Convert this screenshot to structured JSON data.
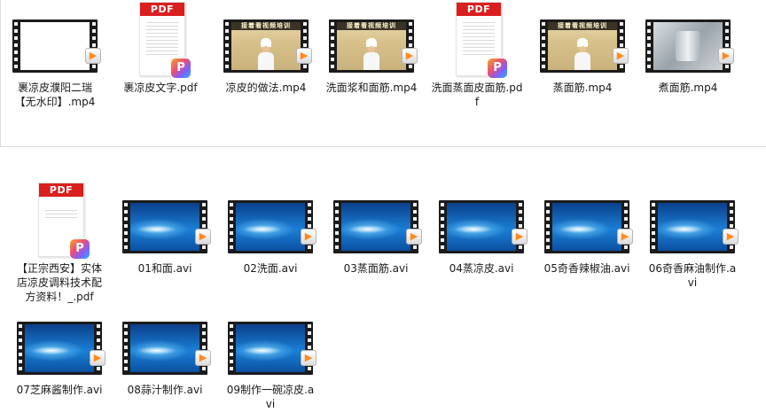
{
  "groups": [
    {
      "items": [
        {
          "type": "video",
          "thumb": "blank",
          "label": "裹凉皮濮阳二瑞【无水印】.mp4"
        },
        {
          "type": "pdf",
          "thumb": "text",
          "label": "裹凉皮文字.pdf"
        },
        {
          "type": "video",
          "thumb": "chef",
          "label": "凉皮的做法.mp4"
        },
        {
          "type": "video",
          "thumb": "chef",
          "label": "洗面浆和面筋.mp4"
        },
        {
          "type": "pdf",
          "thumb": "text",
          "label": "洗面蒸面皮面筋.pdf"
        },
        {
          "type": "video",
          "thumb": "chef",
          "label": "蒸面筋.mp4"
        },
        {
          "type": "video",
          "thumb": "steel",
          "label": "煮面筋.mp4"
        }
      ]
    },
    {
      "items": [
        {
          "type": "pdf",
          "thumb": "sparse",
          "label": "【正宗西安】实体店凉皮调料技术配方资料！_.pdf"
        },
        {
          "type": "video",
          "thumb": "wave",
          "label": "01和面.avi"
        },
        {
          "type": "video",
          "thumb": "wave",
          "label": "02洗面.avi"
        },
        {
          "type": "video",
          "thumb": "wave",
          "label": "03蒸面筋.avi"
        },
        {
          "type": "video",
          "thumb": "wave",
          "label": "04蒸凉皮.avi"
        },
        {
          "type": "video",
          "thumb": "wave",
          "label": "05奇香辣椒油.avi"
        },
        {
          "type": "video",
          "thumb": "wave",
          "label": "06奇香麻油制作.avi"
        },
        {
          "type": "video",
          "thumb": "wave",
          "label": "07芝麻酱制作.avi"
        },
        {
          "type": "video",
          "thumb": "wave",
          "label": "08蒜汁制作.avi"
        },
        {
          "type": "video",
          "thumb": "wave",
          "label": "09制作一碗凉皮.avi"
        }
      ]
    }
  ],
  "pdf_tag": "PDF",
  "pdf_app_glyph": "P",
  "play_glyph": "▶",
  "video_banner": "接着看视频培训",
  "colors": {
    "pdf_red": "#d9201f",
    "play_orange": "#ff8a1c",
    "film_dark": "#1b1b1b",
    "wave_blue": "#1b7fd6",
    "group_border": "#d8dde4"
  }
}
